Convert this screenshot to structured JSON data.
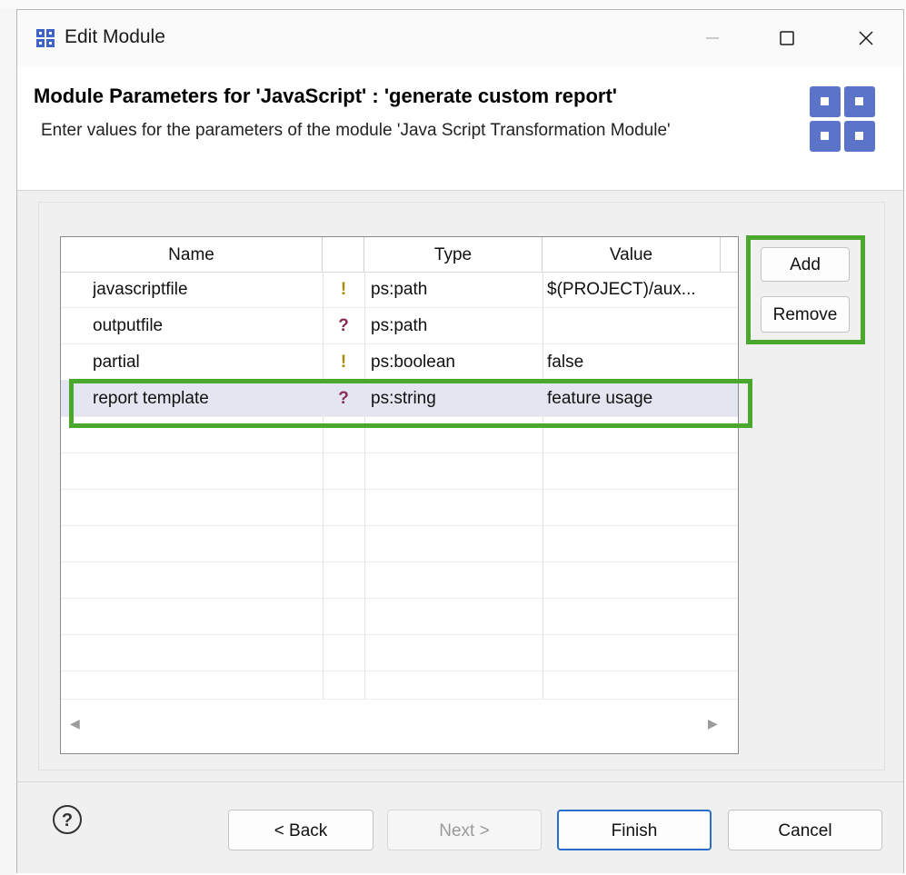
{
  "window": {
    "title": "Edit Module",
    "icons": {
      "app": "module-grid-icon",
      "minimize": "minimize-icon",
      "maximize": "maximize-icon",
      "close": "close-icon"
    }
  },
  "header": {
    "title": "Module Parameters for 'JavaScript' : 'generate custom report'",
    "description": "Enter values for the parameters of the module 'Java Script Transformation Module'",
    "icon": "module-grid-icon",
    "icon_color": "#5b74c9"
  },
  "table": {
    "columns": [
      "Name",
      "",
      "Type",
      "Value"
    ],
    "rows": [
      {
        "name": "javascriptfile",
        "flag": "!",
        "flag_icon": "required-icon",
        "type": "ps:path",
        "value": "$(PROJECT)/aux..."
      },
      {
        "name": "outputfile",
        "flag": "?",
        "flag_icon": "optional-icon",
        "type": "ps:path",
        "value": ""
      },
      {
        "name": "partial",
        "flag": "!",
        "flag_icon": "required-icon",
        "type": "ps:boolean",
        "value": "false"
      },
      {
        "name": "report template",
        "flag": "?",
        "flag_icon": "optional-icon",
        "type": "ps:string",
        "value": "feature usage",
        "selected": true
      }
    ],
    "scroll_icons": {
      "left": "scroll-left-icon",
      "right": "scroll-right-icon"
    }
  },
  "side_buttons": {
    "add": "Add",
    "remove": "Remove"
  },
  "footer": {
    "help_icon": "help-icon",
    "back": "< Back",
    "next": "Next >",
    "finish": "Finish",
    "cancel": "Cancel"
  },
  "colors": {
    "highlight": "#4aa82c",
    "selected_row": "#e3e6f0",
    "default_button_border": "#2a6ecb",
    "required_flag": "#a88c00",
    "optional_flag": "#8a2b58"
  }
}
